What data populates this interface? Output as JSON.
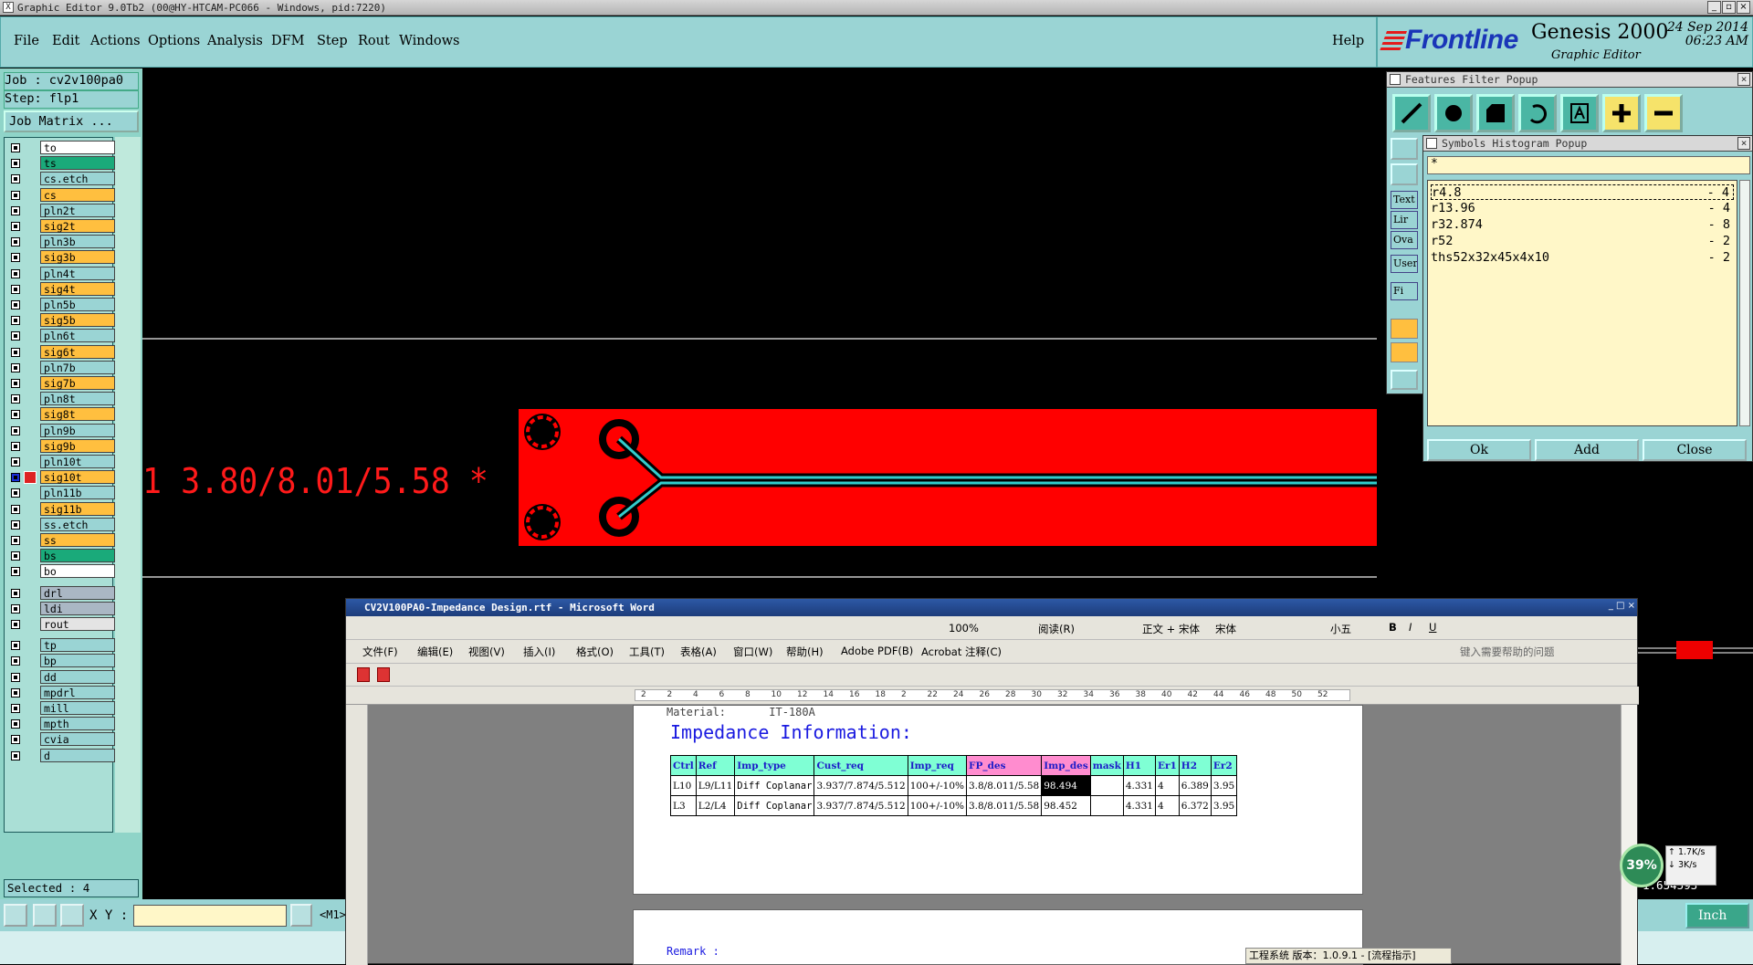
{
  "title_bar": {
    "text": "Graphic Editor 9.0Tb2 (00@HY-HTCAM-PC066 - Windows, pid:7220)"
  },
  "menu": {
    "items": [
      "File",
      "Edit",
      "Actions",
      "Options",
      "Analysis",
      "DFM",
      "Step",
      "Rout",
      "Windows"
    ],
    "help": "Help"
  },
  "brand": {
    "logo": "Frontline",
    "product": "Genesis 2000",
    "subtitle": "Graphic Editor",
    "date": "24 Sep 2014",
    "time": "06:23 AM"
  },
  "left_panel": {
    "job": "Job : cv2v100pa0",
    "step": "Step: flp1",
    "job_matrix": "Job Matrix ...",
    "layers": [
      {
        "name": "to",
        "color": "#ffffff"
      },
      {
        "name": "ts",
        "color": "#1aaa7a"
      },
      {
        "name": "cs.etch",
        "color": "#9ad4d4"
      },
      {
        "name": "cs",
        "color": "#ffbf3f"
      },
      {
        "name": "pln2t",
        "color": "#9ad4d4"
      },
      {
        "name": "sig2t",
        "color": "#ffbf3f"
      },
      {
        "name": "pln3b",
        "color": "#9ad4d4"
      },
      {
        "name": "sig3b",
        "color": "#ffbf3f"
      },
      {
        "name": "pln4t",
        "color": "#9ad4d4"
      },
      {
        "name": "sig4t",
        "color": "#ffbf3f"
      },
      {
        "name": "pln5b",
        "color": "#9ad4d4"
      },
      {
        "name": "sig5b",
        "color": "#ffbf3f"
      },
      {
        "name": "pln6t",
        "color": "#9ad4d4"
      },
      {
        "name": "sig6t",
        "color": "#ffbf3f"
      },
      {
        "name": "pln7b",
        "color": "#9ad4d4"
      },
      {
        "name": "sig7b",
        "color": "#ffbf3f"
      },
      {
        "name": "pln8t",
        "color": "#9ad4d4"
      },
      {
        "name": "sig8t",
        "color": "#ffbf3f"
      },
      {
        "name": "pln9b",
        "color": "#9ad4d4"
      },
      {
        "name": "sig9b",
        "color": "#ffbf3f"
      },
      {
        "name": "pln10t",
        "color": "#9ad4d4"
      },
      {
        "name": "sig10t",
        "color": "#ffbf3f",
        "active": true
      },
      {
        "name": "pln11b",
        "color": "#9ad4d4"
      },
      {
        "name": "sig11b",
        "color": "#ffbf3f"
      },
      {
        "name": "ss.etch",
        "color": "#9ad4d4"
      },
      {
        "name": "ss",
        "color": "#ffbf3f"
      },
      {
        "name": "bs",
        "color": "#1aaa7a"
      },
      {
        "name": "bo",
        "color": "#ffffff"
      },
      {
        "name": "drl",
        "color": "#aab7c4"
      },
      {
        "name": "ldi",
        "color": "#aab7c4"
      },
      {
        "name": "rout",
        "color": "#e4e4e4"
      },
      {
        "name": "tp",
        "color": "#9ad4d4"
      },
      {
        "name": "bp",
        "color": "#9ad4d4"
      },
      {
        "name": "dd",
        "color": "#9ad4d4"
      },
      {
        "name": "mpdrl",
        "color": "#9ad4d4"
      },
      {
        "name": "mill",
        "color": "#9ad4d4"
      },
      {
        "name": "mpth",
        "color": "#9ad4d4"
      },
      {
        "name": "cvia",
        "color": "#9ad4d4"
      },
      {
        "name": "d",
        "color": "#9ad4d4"
      }
    ],
    "selected": "Selected : 4"
  },
  "canvas": {
    "dimension_text": "1 3.80/8.01/5.58 *",
    "trace_color": "#ff0000",
    "line_color": "#33cccc"
  },
  "features_filter": {
    "title": "Features Filter Popup",
    "side_labels": [
      "Text",
      "Lir",
      "Ova",
      "User",
      "Fi"
    ]
  },
  "symbols_histogram": {
    "title": "Symbols Histogram Popup",
    "filter": "*",
    "rows": [
      {
        "symbol": "r4.8",
        "count": "- 4",
        "selected": true
      },
      {
        "symbol": "r13.96",
        "count": "- 4"
      },
      {
        "symbol": "r32.874",
        "count": "- 8"
      },
      {
        "symbol": "r52",
        "count": "- 2"
      },
      {
        "symbol": "ths52x32x45x4x10",
        "count": "- 2"
      }
    ],
    "buttons": [
      "Ok",
      "Add",
      "Close"
    ]
  },
  "bottom_bar": {
    "xy_label": "X Y :",
    "xy_value": "",
    "m1": "<M1>",
    "unit": "Inch"
  },
  "coords": {
    "line1": "5.",
    "line2": "1.654593\""
  },
  "net_monitor": {
    "percent": "39%",
    "up": "1.7K/s",
    "down": "3K/s"
  },
  "word": {
    "title": "CV2V100PA0-Impedance Design.rtf - Microsoft Word",
    "menus": [
      "文件(F)",
      "编辑(E)",
      "视图(V)",
      "插入(I)",
      "格式(O)",
      "工具(T)",
      "表格(A)",
      "窗口(W)",
      "帮助(H)",
      "Adobe PDF(B)",
      "Acrobat 注释(C)"
    ],
    "help_placeholder": "键入需要帮助的问题",
    "zoom": "100%",
    "read_mode": "阅读(R)",
    "style": "正文 + 宋体",
    "font": "宋体",
    "size": "小五",
    "ruler_ticks": [
      "2",
      "2",
      "4",
      "6",
      "8",
      "10",
      "12",
      "14",
      "16",
      "18",
      "2",
      "22",
      "24",
      "26",
      "28",
      "30",
      "32",
      "34",
      "36",
      "38",
      "40",
      "42",
      "44",
      "46",
      "48",
      "50",
      "52"
    ],
    "material_label": "Material:",
    "material_value": "IT-180A",
    "heading": "Impedance Information:",
    "table": {
      "headers": [
        "Ctrl",
        "Ref",
        "Imp_type",
        "Cust_req",
        "Imp_req",
        "FP_des",
        "Imp_des",
        "mask",
        "H1",
        "Er1",
        "H2",
        "Er2"
      ],
      "rows": [
        [
          "L10",
          "L9/L11",
          "Diff Coplanar",
          "3.937/7.874/5.512",
          "100+/-10%",
          "3.8/8.011/5.58",
          "98.494",
          "",
          "4.331",
          "4",
          "6.389",
          "3.95"
        ],
        [
          "L3",
          "L2/L4",
          "Diff Coplanar",
          "3.937/7.874/5.512",
          "100+/-10%",
          "3.8/8.011/5.58",
          "98.452",
          "",
          "4.331",
          "4",
          "6.372",
          "3.95"
        ]
      ]
    },
    "remark": "Remark :"
  },
  "ime_status": "工程系统   版本：1.0.9.1 - [流程指示]"
}
